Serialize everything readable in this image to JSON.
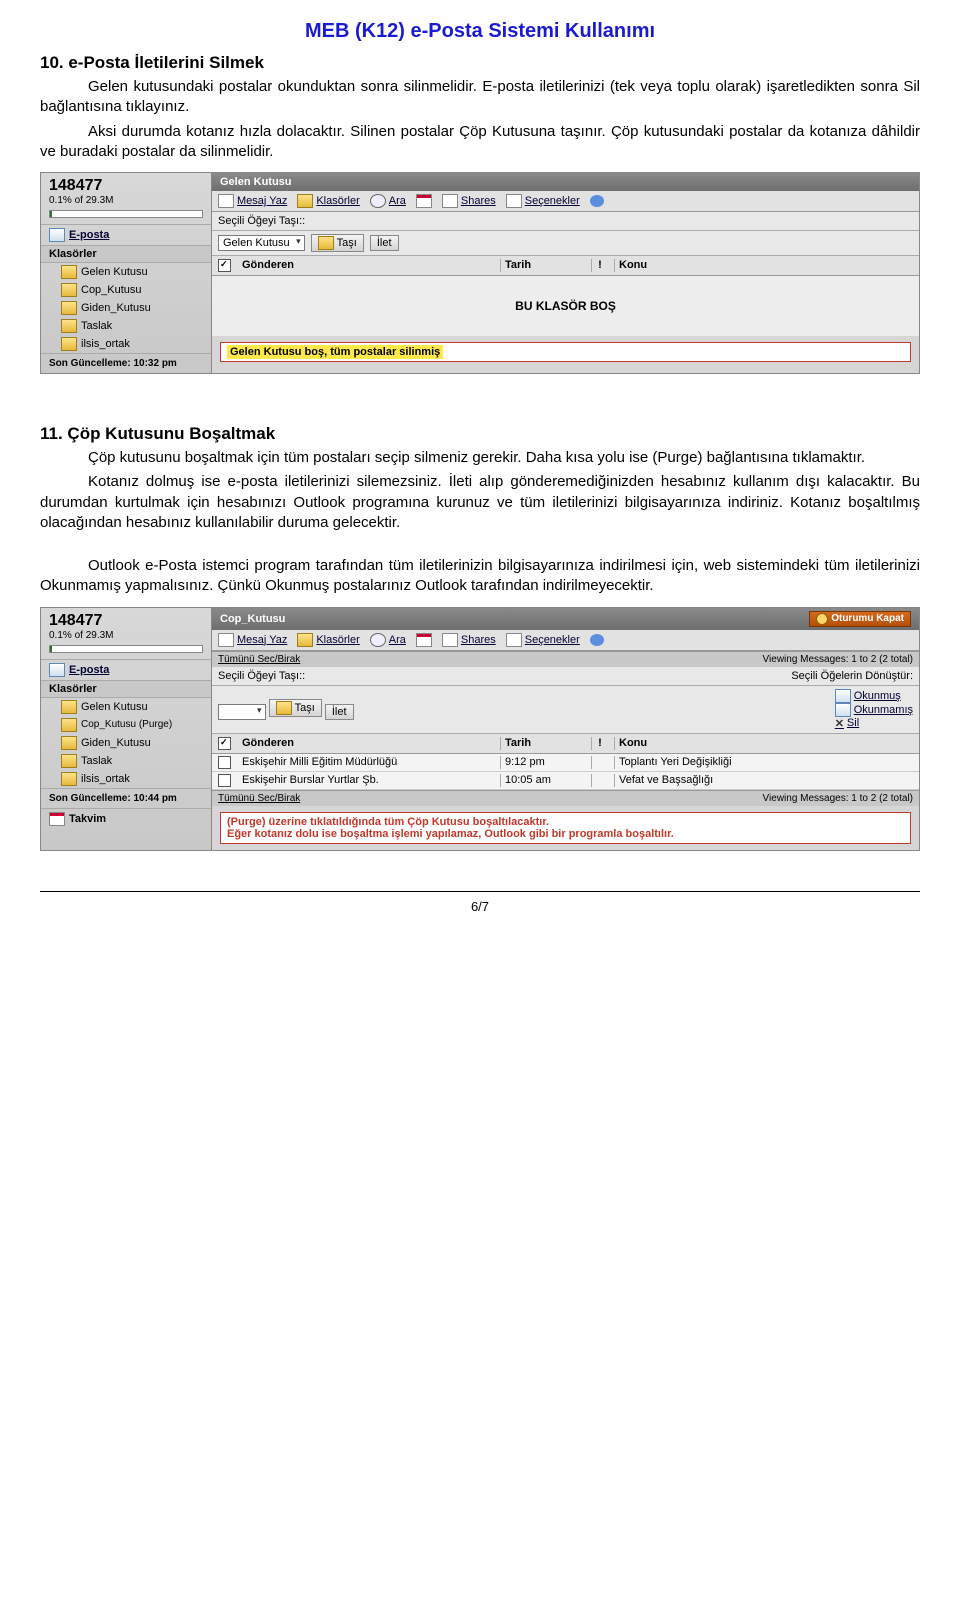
{
  "doc_title": "MEB (K12) e-Posta Sistemi Kullanımı",
  "section10": {
    "heading": "10. e-Posta İletilerini Silmek",
    "p1": "Gelen kutusundaki postalar okunduktan sonra silinmelidir. E-posta iletilerinizi (tek veya toplu olarak) işaretledikten sonra Sil bağlantısına tıklayınız.",
    "p2": "Aksi durumda kotanız hızla dolacaktır. Silinen postalar Çöp Kutusuna taşınır. Çöp kutusundaki postalar da kotanıza dâhildir ve buradaki postalar da silinmelidir."
  },
  "shot1": {
    "quota_num": "148477",
    "quota_pct": "0.1% of 29.3M",
    "eposta": "E-posta",
    "folders_label": "Klasörler",
    "folders": [
      "Gelen Kutusu",
      "Cop_Kutusu",
      "Giden_Kutusu",
      "Taslak",
      "ilsis_ortak"
    ],
    "last_update": "Son Güncelleme: 10:32 pm",
    "titlebar": "Gelen Kutusu",
    "toolbar": [
      "Mesaj Yaz",
      "Klasörler",
      "Ara",
      "Shares",
      "Seçenekler"
    ],
    "move_label": "Seçili Öğeyi Taşı::",
    "move_folder": "Gelen Kutusu",
    "btn_tasi": "Taşı",
    "btn_ilet": "İlet",
    "cols": {
      "from": "Gönderen",
      "date": "Tarih",
      "pri": "!",
      "subj": "Konu"
    },
    "empty_msg": "BU KLASÖR BOŞ",
    "callout": "Gelen Kutusu boş, tüm postalar silinmiş"
  },
  "section11": {
    "heading": "11. Çöp Kutusunu Boşaltmak",
    "p1": "Çöp kutusunu boşaltmak için tüm postaları seçip silmeniz gerekir. Daha kısa yolu ise (Purge) bağlantısına tıklamaktır.",
    "p2": "Kotanız dolmuş ise e-posta iletilerinizi silemezsiniz. İleti alıp gönderemediğinizden hesabınız kullanım dışı kalacaktır. Bu durumdan kurtulmak için hesabınızı Outlook programına kurunuz ve tüm iletilerinizi bilgisayarınıza indiriniz. Kotanız boşaltılmış olacağından hesabınız kullanılabilir duruma gelecektir.",
    "p3": "Outlook e-Posta istemci program tarafından tüm iletilerinizin bilgisayarınıza indirilmesi için, web sistemindeki tüm iletilerinizi Okunmamış yapmalısınız. Çünkü Okunmuş postalarınız Outlook tarafından indirilmeyecektir."
  },
  "shot2": {
    "quota_num": "148477",
    "quota_pct": "0.1% of 29.3M",
    "eposta": "E-posta",
    "folders_label": "Klasörler",
    "folders": [
      "Gelen Kutusu",
      "Cop_Kutusu  (Purge)",
      "Giden_Kutusu",
      "Taslak",
      "ilsis_ortak"
    ],
    "last_update": "Son Güncelleme: 10:44 pm",
    "takvim": "Takvim",
    "titlebar": "Cop_Kutusu",
    "logout": "Oturumu Kapat",
    "toolbar": [
      "Mesaj Yaz",
      "Klasörler",
      "Ara",
      "Shares",
      "Seçenekler"
    ],
    "select_all": "Tümünü Sec/Birak",
    "viewing": "Viewing Messages: 1 to 2 (2 total)",
    "move_label": "Seçili Öğeyi Taşı::",
    "btn_tasi": "Taşı",
    "btn_ilet": "İlet",
    "convert_label": "Seçili Öğelerin Dönüştür:",
    "read": "Okunmuş",
    "unread": "Okunmamış",
    "del": "Sil",
    "cols": {
      "from": "Gönderen",
      "date": "Tarih",
      "pri": "!",
      "subj": "Konu"
    },
    "rows": [
      {
        "from": "Eskişehir Milli Eğitim Müdürlüğü",
        "date": "9:12 pm",
        "subj": "Toplantı Yeri Değişikliği"
      },
      {
        "from": "Eskişehir Burslar Yurtlar Şb.",
        "date": "10:05 am",
        "subj": "Vefat ve Başsağlığı"
      }
    ],
    "callout_l1": "(Purge) üzerine tıklatıldığında tüm Çöp Kutusu boşaltılacaktır.",
    "callout_l2": "Eğer kotanız dolu ise boşaltma işlemi yapılamaz, Outlook gibi bir programla boşaltılır."
  },
  "page_num": "6/7"
}
